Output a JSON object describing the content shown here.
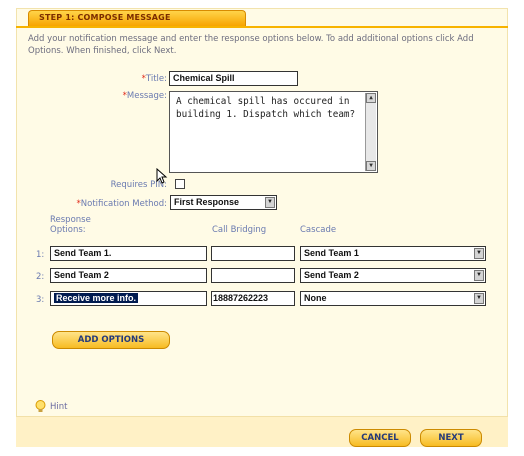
{
  "step_tab": {
    "title": "STEP 1: COMPOSE MESSAGE"
  },
  "intro": "Add your notification message and enter the response options below. To add additional options click Add Options. When finished, click Next.",
  "form": {
    "title_label": "Title:",
    "title_value": "Chemical Spill",
    "message_label": "Message:",
    "message_value": "A chemical spill has occured in building 1. Dispatch which team?",
    "requires_pin_label": "Requires PIN:",
    "requires_pin_checked": false,
    "method_label": "Notification Method:",
    "method_value": "First Response",
    "required_marker": "*"
  },
  "columns": {
    "response_options": "Response Options:",
    "call_bridging": "Call Bridging",
    "cascade": "Cascade"
  },
  "rows": [
    {
      "num": "1:",
      "response": "Send Team 1.",
      "bridge": "",
      "cascade": "Send Team 1"
    },
    {
      "num": "2:",
      "response": "Send Team 2",
      "bridge": "",
      "cascade": "Send Team 2"
    },
    {
      "num": "3:",
      "response": "Receive more info.",
      "bridge": "18887262223",
      "cascade": "None"
    }
  ],
  "buttons": {
    "add_options": "ADD OPTIONS",
    "cancel": "CANCEL",
    "next": "NEXT"
  },
  "hint": {
    "label": "Hint",
    "icon": "lightbulb-icon"
  },
  "colors": {
    "accent": "#f7b300",
    "label": "#6a7ab0",
    "required": "#e02a1a",
    "button_text": "#243a7a"
  }
}
